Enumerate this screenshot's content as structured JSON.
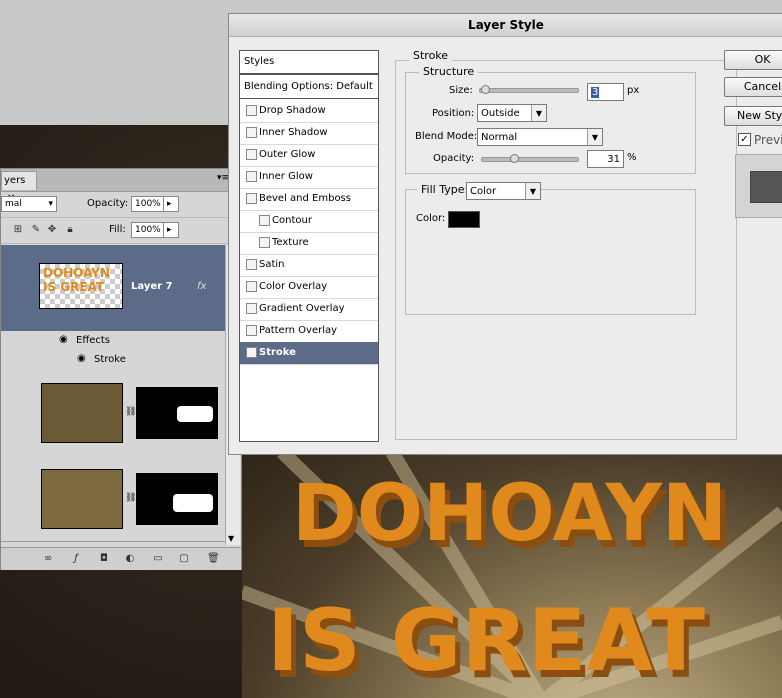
{
  "dialog": {
    "title": "Layer Style",
    "styles_header": "Styles",
    "blending_options": "Blending Options: Default",
    "items": [
      {
        "label": "Drop Shadow",
        "checked": false,
        "indent": false
      },
      {
        "label": "Inner Shadow",
        "checked": false,
        "indent": false
      },
      {
        "label": "Outer Glow",
        "checked": false,
        "indent": false
      },
      {
        "label": "Inner Glow",
        "checked": false,
        "indent": false
      },
      {
        "label": "Bevel and Emboss",
        "checked": false,
        "indent": false
      },
      {
        "label": "Contour",
        "checked": false,
        "indent": true
      },
      {
        "label": "Texture",
        "checked": false,
        "indent": true
      },
      {
        "label": "Satin",
        "checked": false,
        "indent": false
      },
      {
        "label": "Color Overlay",
        "checked": false,
        "indent": false
      },
      {
        "label": "Gradient Overlay",
        "checked": false,
        "indent": false
      },
      {
        "label": "Pattern Overlay",
        "checked": false,
        "indent": false
      },
      {
        "label": "Stroke",
        "checked": true,
        "indent": false,
        "selected": true
      }
    ],
    "stroke": {
      "section_title": "Stroke",
      "structure_title": "Structure",
      "size_label": "Size:",
      "size_value": "3",
      "size_unit": "px",
      "size_fraction": 0.02,
      "position_label": "Position:",
      "position_value": "Outside",
      "blend_mode_label": "Blend Mode:",
      "blend_mode_value": "Normal",
      "opacity_label": "Opacity:",
      "opacity_value": "31",
      "opacity_unit": "%",
      "opacity_fraction": 0.31,
      "fill_type_label": "Fill Type:",
      "fill_type_value": "Color",
      "color_label": "Color:",
      "color_value": "#000000"
    },
    "buttons": {
      "ok": "OK",
      "cancel": "Cancel",
      "new_style": "New Styl",
      "preview": "Previ"
    },
    "preview_checked": true
  },
  "layers_panel": {
    "tab_label": "yers",
    "blend_mode": "mal",
    "opacity_label": "Opacity:",
    "opacity_value": "100%",
    "fill_label": "Fill:",
    "fill_value": "100%",
    "layer_name": "Layer 7",
    "fx_label": "fx",
    "effects_label": "Effects",
    "effect_stroke": "Stroke"
  },
  "art": {
    "line1": "DOHOAYN",
    "line2": "IS GREAT",
    "thumb_text": "DOHOAYN IS GREAT",
    "accent": "#e08a1e",
    "selected_bg": "#5c6b87"
  }
}
